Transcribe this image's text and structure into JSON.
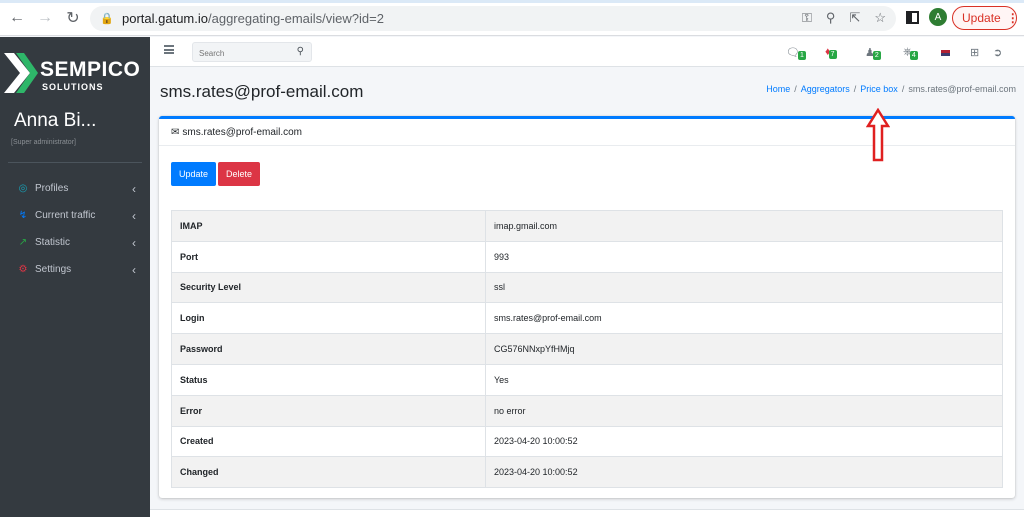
{
  "browser": {
    "url_host": "portal.gatum.io",
    "url_path": "/aggregating-emails/view?id=2",
    "profile_initial": "A",
    "update_label": "Update"
  },
  "sidebar": {
    "brand": "SEMPICO",
    "brand_sub": "SOLUTIONS",
    "user_name": "Anna Bi...",
    "user_role": "[Super administrator]",
    "items": [
      {
        "label": "Profiles",
        "icon": "profiles-icon",
        "color": "#17a2b8"
      },
      {
        "label": "Current traffic",
        "icon": "traffic-icon",
        "color": "#007bff"
      },
      {
        "label": "Statistic",
        "icon": "chart-icon",
        "color": "#28a745"
      },
      {
        "label": "Settings",
        "icon": "gears-icon",
        "color": "#dc3545"
      }
    ]
  },
  "topbar": {
    "search_placeholder": "Search",
    "badges": [
      "1",
      "7",
      "2",
      "4"
    ]
  },
  "header": {
    "title": "sms.rates@prof-email.com",
    "breadcrumb": [
      "Home",
      "Aggregators",
      "Price box",
      "sms.rates@prof-email.com"
    ]
  },
  "card": {
    "title": "sms.rates@prof-email.com",
    "update_label": "Update",
    "delete_label": "Delete",
    "rows": [
      {
        "key": "IMAP",
        "value": "imap.gmail.com"
      },
      {
        "key": "Port",
        "value": "993"
      },
      {
        "key": "Security Level",
        "value": "ssl"
      },
      {
        "key": "Login",
        "value": "sms.rates@prof-email.com"
      },
      {
        "key": "Password",
        "value": "CG576NNxpYfHMjq"
      },
      {
        "key": "Status",
        "value": "Yes"
      },
      {
        "key": "Error",
        "value": "no error"
      },
      {
        "key": "Created",
        "value": "2023-04-20 10:00:52"
      },
      {
        "key": "Changed",
        "value": "2023-04-20 10:00:52"
      }
    ]
  },
  "colors": {
    "primary": "#007bff",
    "danger": "#dc3545",
    "sidebar_bg": "#343a40",
    "badge": "#28a745",
    "annotation": "#e02020"
  }
}
